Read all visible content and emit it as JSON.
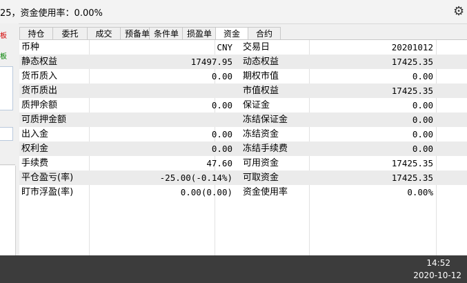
{
  "topbar": {
    "status_text": "25，资金使用率：0.00%",
    "settings_icon": "gear-icon"
  },
  "left_panel": {
    "tag1": "板",
    "tag2": "板",
    "colors": {
      "tag1": "#d40000",
      "tag2": "#008000"
    }
  },
  "tabs": [
    {
      "label": "持仓",
      "active": false
    },
    {
      "label": "委托",
      "active": false
    },
    {
      "label": "成交",
      "active": false
    },
    {
      "label": "预备单",
      "active": false
    },
    {
      "label": "条件单",
      "active": false
    },
    {
      "label": "损盈单",
      "active": false
    },
    {
      "label": "资金",
      "active": true
    },
    {
      "label": "合约",
      "active": false
    }
  ],
  "rows": [
    {
      "l1": "币种",
      "v1": "CNY",
      "l2": "交易日",
      "v2": "20201012"
    },
    {
      "l1": "静态权益",
      "v1": "17497.95",
      "l2": "动态权益",
      "v2": "17425.35"
    },
    {
      "l1": "货币质入",
      "v1": "0.00",
      "l2": "期权市值",
      "v2": "0.00"
    },
    {
      "l1": "货币质出",
      "v1": "",
      "l2": "市值权益",
      "v2": "17425.35"
    },
    {
      "l1": "质押余额",
      "v1": "0.00",
      "l2": "保证金",
      "v2": "0.00"
    },
    {
      "l1": "可质押金额",
      "v1": "",
      "l2": "冻结保证金",
      "v2": "0.00"
    },
    {
      "l1": "出入金",
      "v1": "0.00",
      "l2": "冻结资金",
      "v2": "0.00"
    },
    {
      "l1": "权利金",
      "v1": "0.00",
      "l2": "冻结手续费",
      "v2": "0.00"
    },
    {
      "l1": "手续费",
      "v1": "47.60",
      "l2": "可用资金",
      "v2": "17425.35"
    },
    {
      "l1": "平仓盈亏(率)",
      "v1": "-25.00(-0.14%)",
      "l2": "可取资金",
      "v2": "17425.35"
    },
    {
      "l1": "盯市浮盈(率)",
      "v1": "0.00(0.00)",
      "l2": "资金使用率",
      "v2": "0.00%"
    }
  ],
  "taskbar": {
    "time": "14:52",
    "date": "2020-10-12"
  }
}
